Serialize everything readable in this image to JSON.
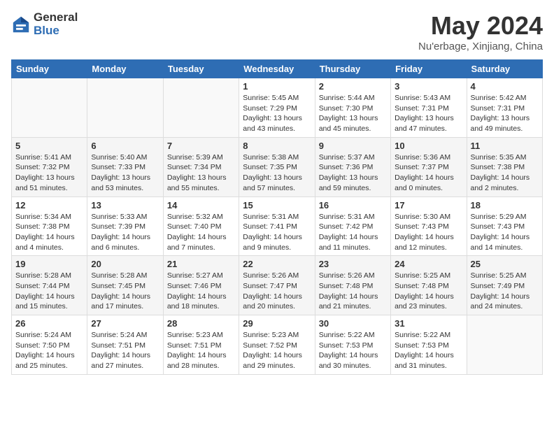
{
  "header": {
    "logo_general": "General",
    "logo_blue": "Blue",
    "title": "May 2024",
    "location": "Nu'erbage, Xinjiang, China"
  },
  "weekdays": [
    "Sunday",
    "Monday",
    "Tuesday",
    "Wednesday",
    "Thursday",
    "Friday",
    "Saturday"
  ],
  "weeks": [
    [
      {
        "day": "",
        "info": ""
      },
      {
        "day": "",
        "info": ""
      },
      {
        "day": "",
        "info": ""
      },
      {
        "day": "1",
        "info": "Sunrise: 5:45 AM\nSunset: 7:29 PM\nDaylight: 13 hours\nand 43 minutes."
      },
      {
        "day": "2",
        "info": "Sunrise: 5:44 AM\nSunset: 7:30 PM\nDaylight: 13 hours\nand 45 minutes."
      },
      {
        "day": "3",
        "info": "Sunrise: 5:43 AM\nSunset: 7:31 PM\nDaylight: 13 hours\nand 47 minutes."
      },
      {
        "day": "4",
        "info": "Sunrise: 5:42 AM\nSunset: 7:31 PM\nDaylight: 13 hours\nand 49 minutes."
      }
    ],
    [
      {
        "day": "5",
        "info": "Sunrise: 5:41 AM\nSunset: 7:32 PM\nDaylight: 13 hours\nand 51 minutes."
      },
      {
        "day": "6",
        "info": "Sunrise: 5:40 AM\nSunset: 7:33 PM\nDaylight: 13 hours\nand 53 minutes."
      },
      {
        "day": "7",
        "info": "Sunrise: 5:39 AM\nSunset: 7:34 PM\nDaylight: 13 hours\nand 55 minutes."
      },
      {
        "day": "8",
        "info": "Sunrise: 5:38 AM\nSunset: 7:35 PM\nDaylight: 13 hours\nand 57 minutes."
      },
      {
        "day": "9",
        "info": "Sunrise: 5:37 AM\nSunset: 7:36 PM\nDaylight: 13 hours\nand 59 minutes."
      },
      {
        "day": "10",
        "info": "Sunrise: 5:36 AM\nSunset: 7:37 PM\nDaylight: 14 hours\nand 0 minutes."
      },
      {
        "day": "11",
        "info": "Sunrise: 5:35 AM\nSunset: 7:38 PM\nDaylight: 14 hours\nand 2 minutes."
      }
    ],
    [
      {
        "day": "12",
        "info": "Sunrise: 5:34 AM\nSunset: 7:38 PM\nDaylight: 14 hours\nand 4 minutes."
      },
      {
        "day": "13",
        "info": "Sunrise: 5:33 AM\nSunset: 7:39 PM\nDaylight: 14 hours\nand 6 minutes."
      },
      {
        "day": "14",
        "info": "Sunrise: 5:32 AM\nSunset: 7:40 PM\nDaylight: 14 hours\nand 7 minutes."
      },
      {
        "day": "15",
        "info": "Sunrise: 5:31 AM\nSunset: 7:41 PM\nDaylight: 14 hours\nand 9 minutes."
      },
      {
        "day": "16",
        "info": "Sunrise: 5:31 AM\nSunset: 7:42 PM\nDaylight: 14 hours\nand 11 minutes."
      },
      {
        "day": "17",
        "info": "Sunrise: 5:30 AM\nSunset: 7:43 PM\nDaylight: 14 hours\nand 12 minutes."
      },
      {
        "day": "18",
        "info": "Sunrise: 5:29 AM\nSunset: 7:43 PM\nDaylight: 14 hours\nand 14 minutes."
      }
    ],
    [
      {
        "day": "19",
        "info": "Sunrise: 5:28 AM\nSunset: 7:44 PM\nDaylight: 14 hours\nand 15 minutes."
      },
      {
        "day": "20",
        "info": "Sunrise: 5:28 AM\nSunset: 7:45 PM\nDaylight: 14 hours\nand 17 minutes."
      },
      {
        "day": "21",
        "info": "Sunrise: 5:27 AM\nSunset: 7:46 PM\nDaylight: 14 hours\nand 18 minutes."
      },
      {
        "day": "22",
        "info": "Sunrise: 5:26 AM\nSunset: 7:47 PM\nDaylight: 14 hours\nand 20 minutes."
      },
      {
        "day": "23",
        "info": "Sunrise: 5:26 AM\nSunset: 7:48 PM\nDaylight: 14 hours\nand 21 minutes."
      },
      {
        "day": "24",
        "info": "Sunrise: 5:25 AM\nSunset: 7:48 PM\nDaylight: 14 hours\nand 23 minutes."
      },
      {
        "day": "25",
        "info": "Sunrise: 5:25 AM\nSunset: 7:49 PM\nDaylight: 14 hours\nand 24 minutes."
      }
    ],
    [
      {
        "day": "26",
        "info": "Sunrise: 5:24 AM\nSunset: 7:50 PM\nDaylight: 14 hours\nand 25 minutes."
      },
      {
        "day": "27",
        "info": "Sunrise: 5:24 AM\nSunset: 7:51 PM\nDaylight: 14 hours\nand 27 minutes."
      },
      {
        "day": "28",
        "info": "Sunrise: 5:23 AM\nSunset: 7:51 PM\nDaylight: 14 hours\nand 28 minutes."
      },
      {
        "day": "29",
        "info": "Sunrise: 5:23 AM\nSunset: 7:52 PM\nDaylight: 14 hours\nand 29 minutes."
      },
      {
        "day": "30",
        "info": "Sunrise: 5:22 AM\nSunset: 7:53 PM\nDaylight: 14 hours\nand 30 minutes."
      },
      {
        "day": "31",
        "info": "Sunrise: 5:22 AM\nSunset: 7:53 PM\nDaylight: 14 hours\nand 31 minutes."
      },
      {
        "day": "",
        "info": ""
      }
    ]
  ]
}
